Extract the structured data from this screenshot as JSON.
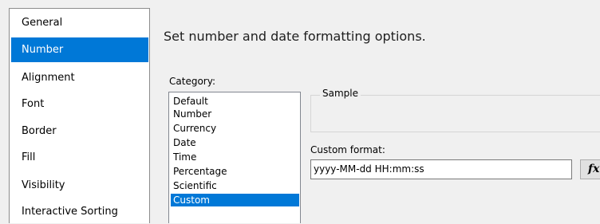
{
  "sidebar": {
    "items": [
      {
        "label": "General"
      },
      {
        "label": "Number"
      },
      {
        "label": "Alignment"
      },
      {
        "label": "Font"
      },
      {
        "label": "Border"
      },
      {
        "label": "Fill"
      },
      {
        "label": "Visibility"
      },
      {
        "label": "Interactive Sorting"
      }
    ],
    "selected": "Number"
  },
  "main": {
    "description": "Set number and date formatting options.",
    "category_label": "Category:",
    "categories": [
      "Default",
      "Number",
      "Currency",
      "Date",
      "Time",
      "Percentage",
      "Scientific",
      "Custom"
    ],
    "selected_category": "Custom",
    "sample_label": "Sample",
    "custom_format_label": "Custom format:",
    "custom_format_value": "yyyy-MM-dd HH:mm:ss",
    "fx_icon": "function-icon",
    "fx_glyph": "fx"
  },
  "colors": {
    "selection": "#0078d7",
    "background": "#f0f0f0"
  }
}
